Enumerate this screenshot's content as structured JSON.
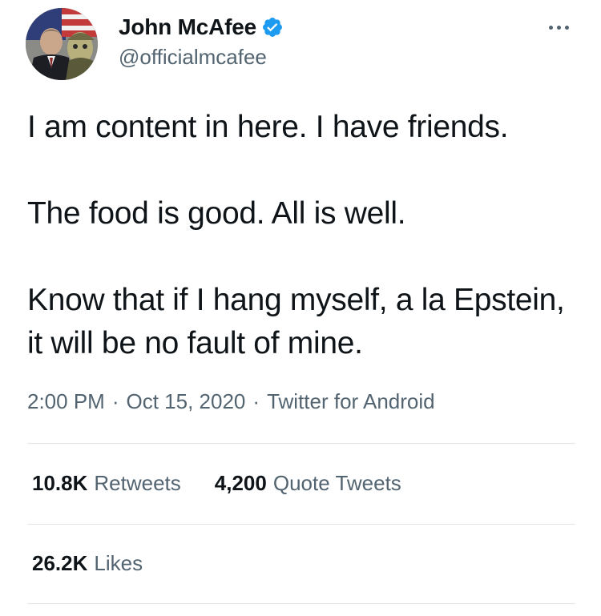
{
  "tweet": {
    "author": {
      "display_name": "John McAfee",
      "handle": "@officialmcafee",
      "verified": true,
      "avatar_icon": "profile-avatar-photo"
    },
    "more_icon": "more-options-icon",
    "text": {
      "line1": "I am content in here. I have friends.",
      "line2": "The food is good. All is well.",
      "line3": "Know that if I hang myself, a la Epstein, it will be no fault of mine."
    },
    "meta": {
      "time": "2:00 PM",
      "separator": "·",
      "date": "Oct 15, 2020",
      "source": "Twitter for Android"
    },
    "stats": {
      "retweets_count": "10.8K",
      "retweets_label": "Retweets",
      "quotes_count": "4,200",
      "quotes_label": "Quote Tweets",
      "likes_count": "26.2K",
      "likes_label": "Likes"
    },
    "colors": {
      "text_primary": "#0f1419",
      "text_secondary": "#536471",
      "verified_blue": "#1d9bf0",
      "divider": "#e1e6ea"
    }
  }
}
